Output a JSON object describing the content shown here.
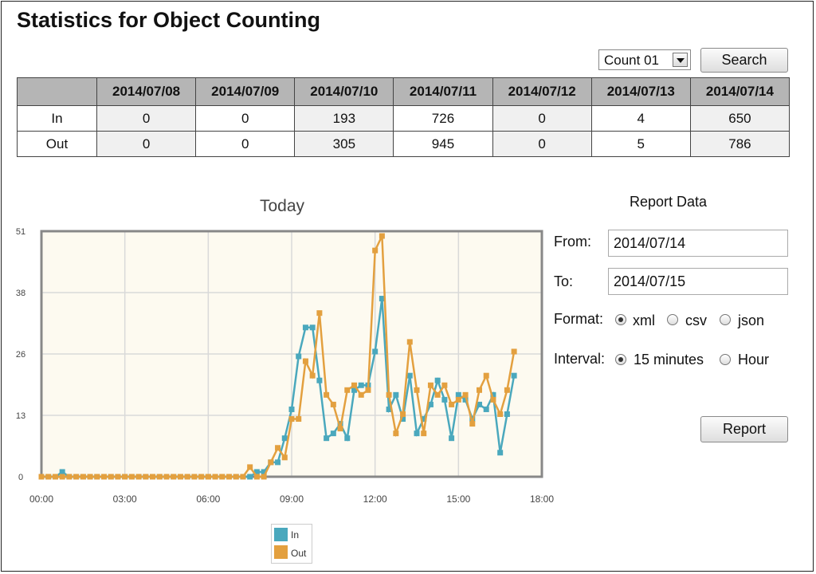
{
  "page": {
    "title": "Statistics for Object Counting"
  },
  "filter": {
    "counter": "Count 01",
    "search_label": "Search"
  },
  "table": {
    "dates": [
      "2014/07/08",
      "2014/07/09",
      "2014/07/10",
      "2014/07/11",
      "2014/07/12",
      "2014/07/13",
      "2014/07/14"
    ],
    "rows": [
      {
        "label": "In",
        "values": [
          "0",
          "0",
          "193",
          "726",
          "0",
          "4",
          "650"
        ]
      },
      {
        "label": "Out",
        "values": [
          "0",
          "0",
          "305",
          "945",
          "0",
          "5",
          "786"
        ]
      }
    ]
  },
  "chart_data": {
    "type": "line",
    "title": "Today",
    "x_ticks": [
      "00:00",
      "03:00",
      "06:00",
      "09:00",
      "12:00",
      "15:00",
      "18:00"
    ],
    "y_ticks": [
      "0",
      "13",
      "26",
      "38",
      "51"
    ],
    "xlim": [
      0,
      18
    ],
    "ylim": [
      0,
      51
    ],
    "grid": true,
    "legend_position": "bottom",
    "series": [
      {
        "name": "In",
        "color": "#4aa8bd",
        "points": [
          [
            0,
            0
          ],
          [
            0.25,
            0
          ],
          [
            0.5,
            0
          ],
          [
            0.75,
            1
          ],
          [
            1,
            0
          ],
          [
            1.25,
            0
          ],
          [
            1.5,
            0
          ],
          [
            1.75,
            0
          ],
          [
            2,
            0
          ],
          [
            2.25,
            0
          ],
          [
            2.5,
            0
          ],
          [
            2.75,
            0
          ],
          [
            3,
            0
          ],
          [
            3.25,
            0
          ],
          [
            3.5,
            0
          ],
          [
            3.75,
            0
          ],
          [
            4,
            0
          ],
          [
            4.25,
            0
          ],
          [
            4.5,
            0
          ],
          [
            4.75,
            0
          ],
          [
            5,
            0
          ],
          [
            5.25,
            0
          ],
          [
            5.5,
            0
          ],
          [
            5.75,
            0
          ],
          [
            6,
            0
          ],
          [
            6.25,
            0
          ],
          [
            6.5,
            0
          ],
          [
            6.75,
            0
          ],
          [
            7,
            0
          ],
          [
            7.25,
            0
          ],
          [
            7.5,
            0
          ],
          [
            7.75,
            1
          ],
          [
            8,
            1
          ],
          [
            8.25,
            3
          ],
          [
            8.5,
            3
          ],
          [
            8.75,
            8
          ],
          [
            9,
            14
          ],
          [
            9.25,
            25
          ],
          [
            9.5,
            31
          ],
          [
            9.75,
            31
          ],
          [
            10,
            20
          ],
          [
            10.25,
            8
          ],
          [
            10.5,
            9
          ],
          [
            10.75,
            11
          ],
          [
            11,
            8
          ],
          [
            11.25,
            18
          ],
          [
            11.5,
            19
          ],
          [
            11.75,
            19
          ],
          [
            12,
            26
          ],
          [
            12.25,
            37
          ],
          [
            12.5,
            14
          ],
          [
            12.75,
            17
          ],
          [
            13,
            12
          ],
          [
            13.25,
            21
          ],
          [
            13.5,
            9
          ],
          [
            13.75,
            12
          ],
          [
            14,
            15
          ],
          [
            14.25,
            20
          ],
          [
            14.5,
            16
          ],
          [
            14.75,
            8
          ],
          [
            15,
            17
          ],
          [
            15.25,
            16
          ],
          [
            15.5,
            12
          ],
          [
            15.75,
            15
          ],
          [
            16,
            14
          ],
          [
            16.25,
            17
          ],
          [
            16.5,
            5
          ],
          [
            16.75,
            13
          ],
          [
            17,
            21
          ]
        ]
      },
      {
        "name": "Out",
        "color": "#e3a03f",
        "points": [
          [
            0,
            0
          ],
          [
            0.25,
            0
          ],
          [
            0.5,
            0
          ],
          [
            0.75,
            0
          ],
          [
            1,
            0
          ],
          [
            1.25,
            0
          ],
          [
            1.5,
            0
          ],
          [
            1.75,
            0
          ],
          [
            2,
            0
          ],
          [
            2.25,
            0
          ],
          [
            2.5,
            0
          ],
          [
            2.75,
            0
          ],
          [
            3,
            0
          ],
          [
            3.25,
            0
          ],
          [
            3.5,
            0
          ],
          [
            3.75,
            0
          ],
          [
            4,
            0
          ],
          [
            4.25,
            0
          ],
          [
            4.5,
            0
          ],
          [
            4.75,
            0
          ],
          [
            5,
            0
          ],
          [
            5.25,
            0
          ],
          [
            5.5,
            0
          ],
          [
            5.75,
            0
          ],
          [
            6,
            0
          ],
          [
            6.25,
            0
          ],
          [
            6.5,
            0
          ],
          [
            6.75,
            0
          ],
          [
            7,
            0
          ],
          [
            7.25,
            0
          ],
          [
            7.5,
            2
          ],
          [
            7.75,
            0
          ],
          [
            8,
            0
          ],
          [
            8.25,
            3
          ],
          [
            8.5,
            6
          ],
          [
            8.75,
            4
          ],
          [
            9,
            12
          ],
          [
            9.25,
            12
          ],
          [
            9.5,
            24
          ],
          [
            9.75,
            21
          ],
          [
            10,
            34
          ],
          [
            10.25,
            17
          ],
          [
            10.5,
            15
          ],
          [
            10.75,
            10
          ],
          [
            11,
            18
          ],
          [
            11.25,
            19
          ],
          [
            11.5,
            17
          ],
          [
            11.75,
            18
          ],
          [
            12,
            47
          ],
          [
            12.25,
            50
          ],
          [
            12.5,
            17
          ],
          [
            12.75,
            9
          ],
          [
            13,
            13
          ],
          [
            13.25,
            28
          ],
          [
            13.5,
            18
          ],
          [
            13.75,
            9
          ],
          [
            14,
            19
          ],
          [
            14.25,
            17
          ],
          [
            14.5,
            19
          ],
          [
            14.75,
            15
          ],
          [
            15,
            16
          ],
          [
            15.25,
            17
          ],
          [
            15.5,
            11
          ],
          [
            15.75,
            18
          ],
          [
            16,
            21
          ],
          [
            16.25,
            16
          ],
          [
            16.5,
            13
          ],
          [
            16.75,
            18
          ],
          [
            17,
            26
          ]
        ]
      }
    ]
  },
  "report": {
    "title": "Report Data",
    "from_label": "From:",
    "from_value": "2014/07/14",
    "to_label": "To:",
    "to_value": "2014/07/15",
    "format_label": "Format:",
    "format_options": [
      "xml",
      "csv",
      "json"
    ],
    "format_selected": "xml",
    "interval_label": "Interval:",
    "interval_options": [
      "15 minutes",
      "Hour"
    ],
    "interval_selected": "15 minutes",
    "button_label": "Report"
  }
}
